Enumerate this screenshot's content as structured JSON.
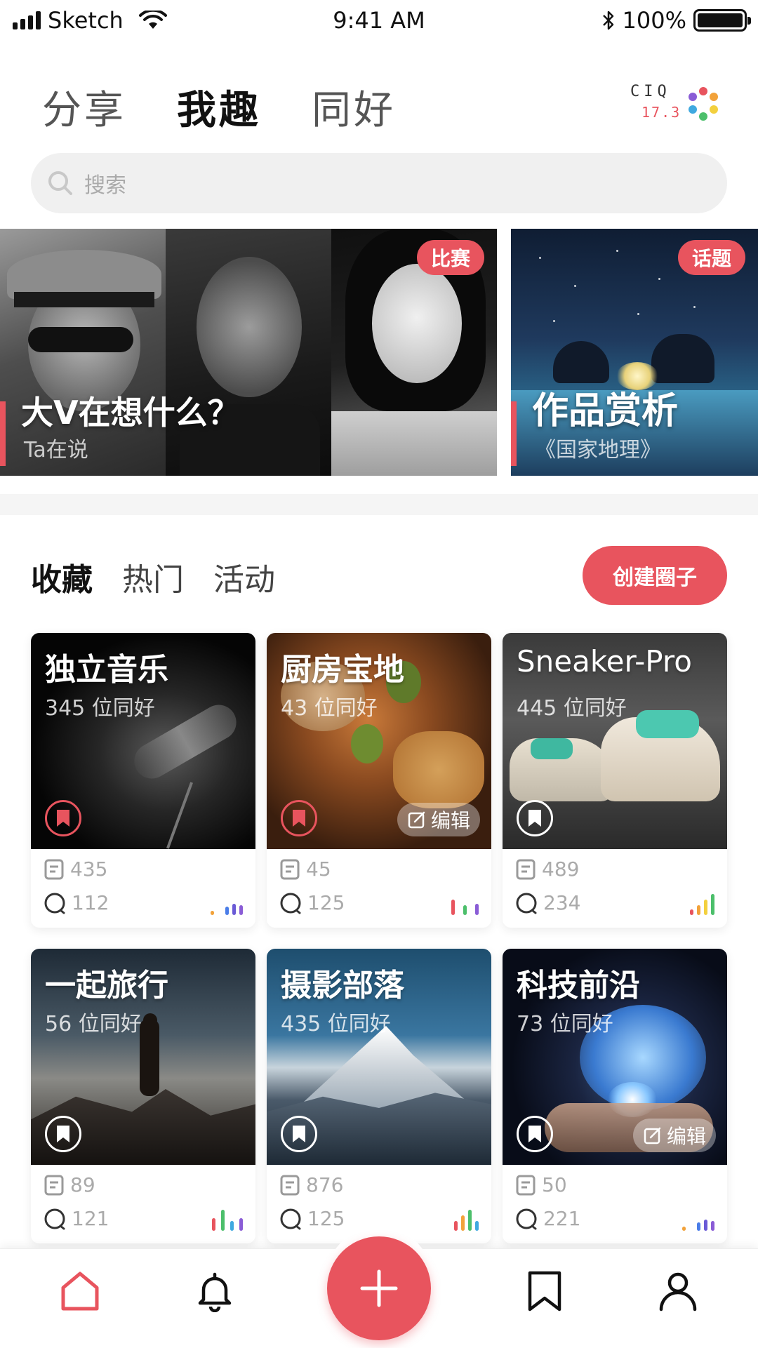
{
  "status_bar": {
    "carrier": "Sketch",
    "time": "9:41 AM",
    "battery": "100%"
  },
  "header": {
    "tabs": [
      "分享",
      "我趣",
      "同好"
    ],
    "active_tab": "我趣",
    "logo": {
      "text": "CIQ",
      "number": "17.3"
    }
  },
  "search": {
    "placeholder": "搜索"
  },
  "banners": [
    {
      "title": "大V在想什么？",
      "subtitle": "Ta在说",
      "tag": "比赛"
    },
    {
      "title": "作品赏析",
      "subtitle": "《国家地理》",
      "tag": "话题"
    }
  ],
  "section": {
    "tabs": [
      "收藏",
      "热门",
      "活动"
    ],
    "active_tab": "收藏",
    "create_button": "创建圈子"
  },
  "cards": [
    {
      "title": "独立音乐",
      "members": "345 位同好",
      "posts": "435",
      "comments": "112",
      "bookmarked": true,
      "edit": ""
    },
    {
      "title": "厨房宝地",
      "members": "43 位同好",
      "posts": "45",
      "comments": "125",
      "bookmarked": true,
      "edit": "编辑"
    },
    {
      "title": "Sneaker-Pro",
      "members": "445 位同好",
      "posts": "489",
      "comments": "234",
      "bookmarked": false,
      "edit": ""
    },
    {
      "title": "一起旅行",
      "members": "56 位同好",
      "posts": "89",
      "comments": "121",
      "bookmarked": false,
      "edit": ""
    },
    {
      "title": "摄影部落",
      "members": "435 位同好",
      "posts": "876",
      "comments": "125",
      "bookmarked": false,
      "edit": ""
    },
    {
      "title": "科技前沿",
      "members": "73 位同好",
      "posts": "50",
      "comments": "221",
      "bookmarked": false,
      "edit": "编辑"
    }
  ],
  "colors": {
    "accent": "#e8545e",
    "muted": "#aaaaaa"
  },
  "tabbar": {
    "items": [
      "home-icon",
      "bell-icon",
      "plus-icon",
      "bookmark-icon",
      "user-icon"
    ],
    "active": "home-icon"
  }
}
